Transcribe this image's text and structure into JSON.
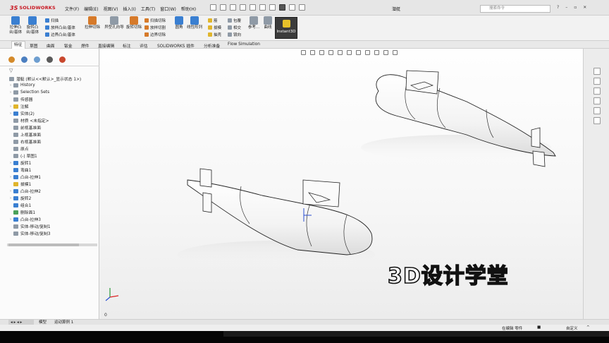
{
  "app": {
    "logo_prefix": "3S",
    "logo_text": "SOLIDWORKS",
    "document_title": "潜艇"
  },
  "menu": [
    "文件(F)",
    "编辑(E)",
    "视图(V)",
    "插入(I)",
    "工具(T)",
    "窗口(W)",
    "帮助(H)"
  ],
  "search": {
    "placeholder": "搜索命令"
  },
  "command_manager": {
    "extrude_boss": "拉伸凸台/基体",
    "revolve_boss": "旋转凸台/基体",
    "sweep_boss": "扫描",
    "loft_boss": "放样凸台/基体",
    "boundary_boss": "边界凸台/基体",
    "extrude_cut": "拉伸切除",
    "hole_wizard": "异型孔向导",
    "revolve_cut": "旋转切除",
    "sweep_cut": "扫描切除",
    "loft_cut": "放样切割",
    "boundary_cut": "边界切除",
    "fillet": "圆角",
    "linear_pattern": "线性阵列",
    "rib": "筋",
    "draft": "拔模",
    "shell": "抽壳",
    "wrap": "包覆",
    "intersect": "相交",
    "mirror": "镜向",
    "reference_geometry": "参考...",
    "curves": "曲线",
    "instant3d": "Instant3D"
  },
  "tabs": [
    "特征",
    "草图",
    "曲面",
    "钣金",
    "焊件",
    "直接编辑",
    "标注",
    "评估",
    "SOLIDWORKS 插件",
    "分析准备",
    "Flow Simulation"
  ],
  "feature_tree": {
    "root": "潜艇 (默认<<默认>_显示状态 1>)",
    "items": [
      "History",
      "Selection Sets",
      "传感器",
      "注解",
      "实体(2)",
      "材质 <未指定>",
      "前视基准面",
      "上视基准面",
      "右视基准面",
      "原点",
      "(-) 草图1",
      "旋转1",
      "弯曲1",
      "凸台-拉伸1",
      "拔模1",
      "凸台-拉伸2",
      "旋转2",
      "组合1",
      "删除面1",
      "凸台-拉伸3",
      "实体-移动/复制1",
      "实体-移动/复制3"
    ]
  },
  "viewport": {
    "watermark": "3D设计学堂",
    "corner_value": "0"
  },
  "status": {
    "tab_model": "模型",
    "tab_motion": "运动算例 1",
    "editing": "在编辑 零件",
    "custom": "自定义"
  }
}
